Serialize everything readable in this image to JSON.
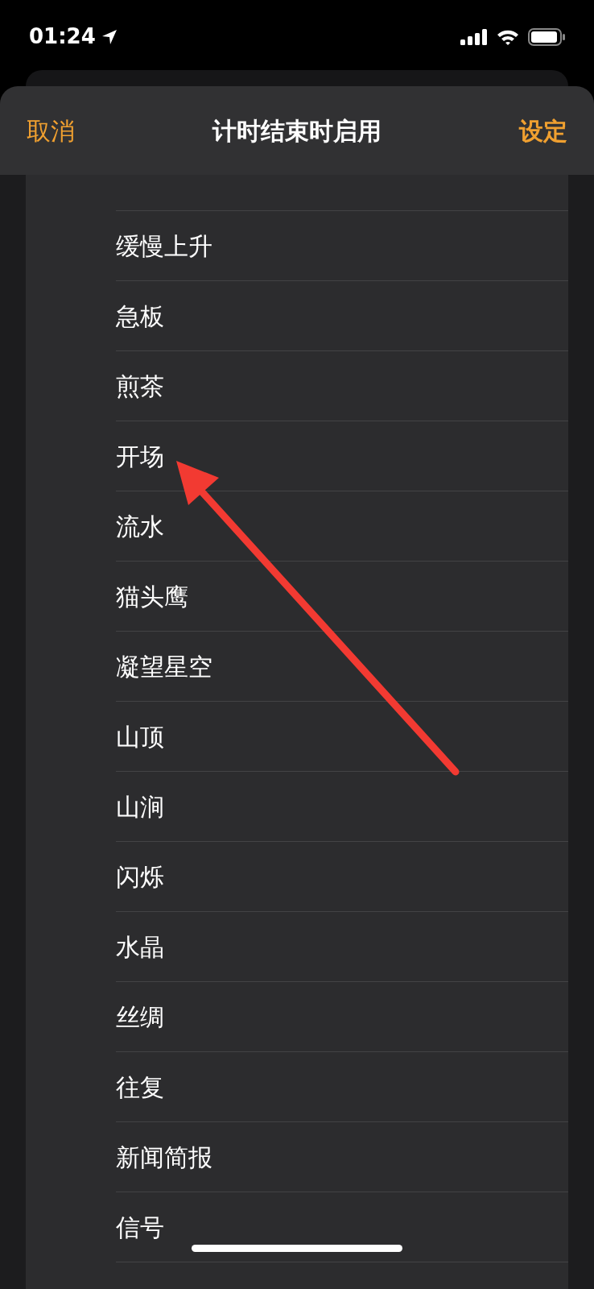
{
  "status_bar": {
    "time": "01:24"
  },
  "header": {
    "cancel": "取消",
    "title": "计时结束时启用",
    "confirm": "设定"
  },
  "sounds": [
    {
      "label": "缓慢上升"
    },
    {
      "label": "急板"
    },
    {
      "label": "煎茶"
    },
    {
      "label": "开场"
    },
    {
      "label": "流水"
    },
    {
      "label": "猫头鹰"
    },
    {
      "label": "凝望星空"
    },
    {
      "label": "山顶"
    },
    {
      "label": "山涧"
    },
    {
      "label": "闪烁"
    },
    {
      "label": "水晶"
    },
    {
      "label": "丝绸"
    },
    {
      "label": "往复"
    },
    {
      "label": "新闻简报"
    },
    {
      "label": "信号"
    }
  ]
}
